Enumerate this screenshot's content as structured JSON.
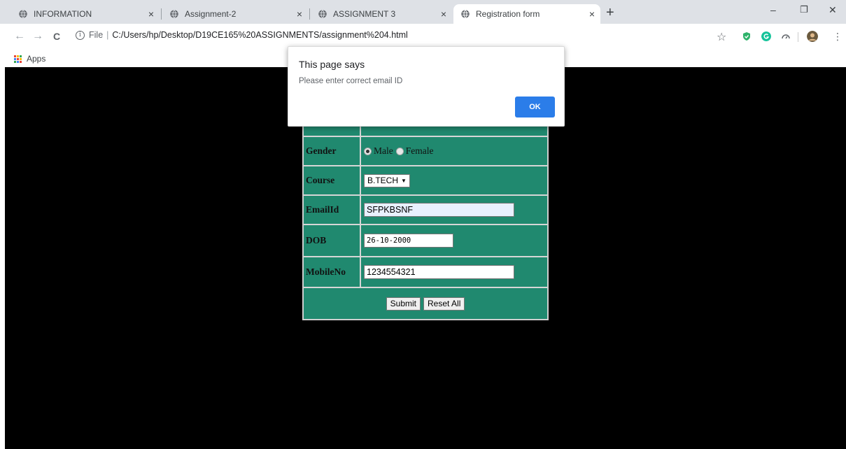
{
  "browser": {
    "tabs": [
      {
        "title": "INFORMATION"
      },
      {
        "title": "Assignment-2"
      },
      {
        "title": "ASSIGNMENT 3"
      },
      {
        "title": "Registration form"
      }
    ],
    "tab_close_glyph": "×",
    "new_tab_glyph": "+",
    "window_controls": {
      "minimize": "–",
      "restore": "❐",
      "close": "✕"
    },
    "nav": {
      "back": "←",
      "forward": "→",
      "reload": "C"
    },
    "address": {
      "info_glyph": "i",
      "scheme": "File",
      "separator": "|",
      "url": "C:/Users/hp/Desktop/D19CE165%20ASSIGNMENTS/assignment%204.html"
    },
    "star_glyph": "☆",
    "menu_glyph": "⋮",
    "bookmarks": {
      "apps_label": "Apps"
    },
    "extension_icons": [
      "shield-icon",
      "grammarly-icon",
      "speed-icon",
      "profile-avatar"
    ]
  },
  "form": {
    "rows": [
      {
        "label": "Gender",
        "options": [
          {
            "label": "Male",
            "checked": true
          },
          {
            "label": "Female",
            "checked": false
          }
        ]
      },
      {
        "label": "Course",
        "value": "B.TECH"
      },
      {
        "label": "EmailId",
        "value": "SFPKBSNF"
      },
      {
        "label": "DOB",
        "value": "26-10-2000"
      },
      {
        "label": "MobileNo",
        "value": "1234554321"
      }
    ],
    "submit_label": "Submit",
    "reset_label": "Reset All"
  },
  "dialog": {
    "title": "This page says",
    "message": "Please enter correct email ID",
    "ok_label": "OK"
  },
  "colors": {
    "form_bg": "#20896f",
    "page_bg": "#000000",
    "ok_button": "#2b7de9",
    "autofill_bg": "#e8f0fe"
  }
}
